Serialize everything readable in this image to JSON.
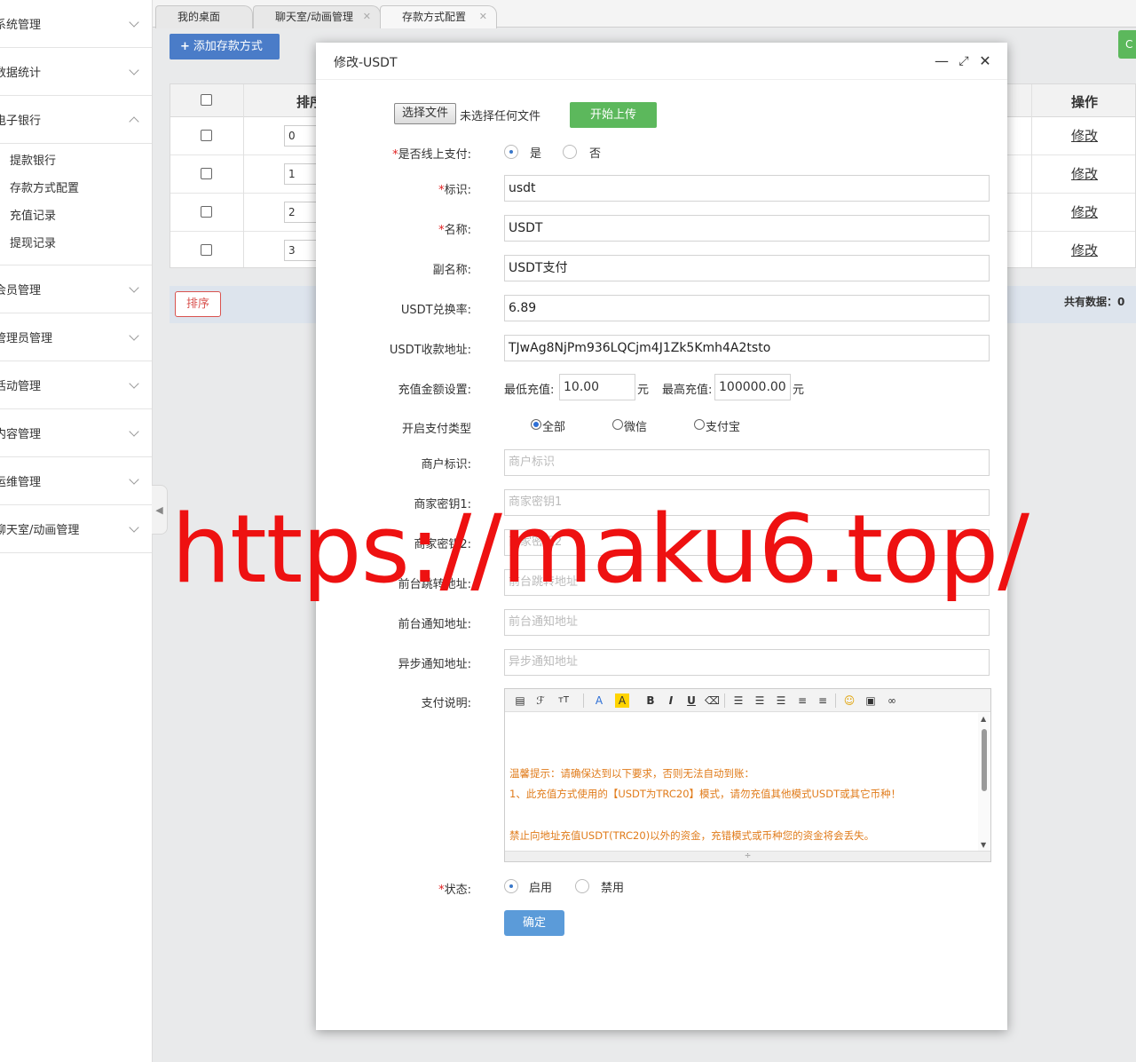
{
  "sidebar": {
    "groups_top": [
      {
        "label": "系统管理"
      },
      {
        "label": "数据统计"
      },
      {
        "label": "电子银行"
      }
    ],
    "sub_items": [
      {
        "label": "提款银行"
      },
      {
        "label": "存款方式配置"
      },
      {
        "label": "充值记录"
      },
      {
        "label": "提现记录"
      }
    ],
    "groups_bottom": [
      {
        "label": "会员管理"
      },
      {
        "label": "管理员管理"
      },
      {
        "label": "活动管理"
      },
      {
        "label": "内容管理"
      },
      {
        "label": "运维管理"
      },
      {
        "label": "聊天室/动画管理"
      }
    ]
  },
  "tabs": [
    {
      "label": "我的桌面"
    },
    {
      "label": "聊天室/动画管理"
    },
    {
      "label": "存款方式配置"
    }
  ],
  "toolbar": {
    "add_label": "添加存款方式",
    "green_label": "C"
  },
  "grid": {
    "headers": {
      "sort": "排序",
      "actions": "操作"
    },
    "rows": [
      {
        "sort": "0",
        "action": "修改"
      },
      {
        "sort": "1",
        "action": "修改"
      },
      {
        "sort": "2",
        "action": "修改"
      },
      {
        "sort": "3",
        "action": "修改"
      }
    ],
    "sort_button": "排序",
    "total": "共有数据：0"
  },
  "modal": {
    "title": "修改-USDT",
    "file_button": "选择文件",
    "file_status": "未选择任何文件",
    "upload_button": "开始上传",
    "online_pay": {
      "label": "是否线上支付:",
      "yes": "是",
      "no": "否",
      "selected": "是"
    },
    "ident": {
      "label": "标识:",
      "value": "usdt"
    },
    "name": {
      "label": "名称:",
      "value": "USDT"
    },
    "subname": {
      "label": "副名称:",
      "value": "USDT支付"
    },
    "rate": {
      "label": "USDT兑换率:",
      "value": "6.89"
    },
    "address": {
      "label": "USDT收款地址:",
      "value": "TJwAg8NjPm936LQCjm4J1Zk5Kmh4A2tsto"
    },
    "amount": {
      "label": "充值金额设置:",
      "min_label": "最低充值:",
      "min_value": "10.00",
      "max_label": "最高充值:",
      "max_value": "100000.00",
      "unit": "元"
    },
    "pay_type": {
      "label": "开启支付类型",
      "options": [
        "全部",
        "微信",
        "支付宝"
      ],
      "selected": "全部"
    },
    "merchant_id": {
      "label": "商户标识:",
      "placeholder": "商户标识"
    },
    "key1": {
      "label": "商家密钥1:",
      "placeholder": "商家密钥1"
    },
    "key2": {
      "label": "商家密钥2:",
      "placeholder": "商家密钥2"
    },
    "front_jump": {
      "label": "前台跳转地址:",
      "placeholder": "前台跳转地址"
    },
    "front_notify": {
      "label": "前台通知地址:",
      "placeholder": "前台通知地址"
    },
    "async_notify": {
      "label": "异步通知地址:",
      "placeholder": "异步通知地址"
    },
    "description": {
      "label": "支付说明:",
      "lines": [
        "温馨提示：请确保达到以下要求，否则无法自动到账：",
        "1、此充值方式使用的【USDT为TRC20】模式，请勿充值其他模式USDT或其它币种！",
        "禁止向地址充值USDT(TRC20)以外的资金，充错模式或币种您的资金将会丢失。"
      ]
    },
    "status": {
      "label": "状态:",
      "enable": "启用",
      "disable": "禁用",
      "selected": "启用"
    },
    "confirm": "确定"
  },
  "watermark": "https://maku6.top/",
  "colors": {
    "accent": "#4a7cc8",
    "upload": "#5cb85c",
    "danger": "#d9534f",
    "warning_text": "#e07b1a",
    "watermark": "#ee1111"
  }
}
